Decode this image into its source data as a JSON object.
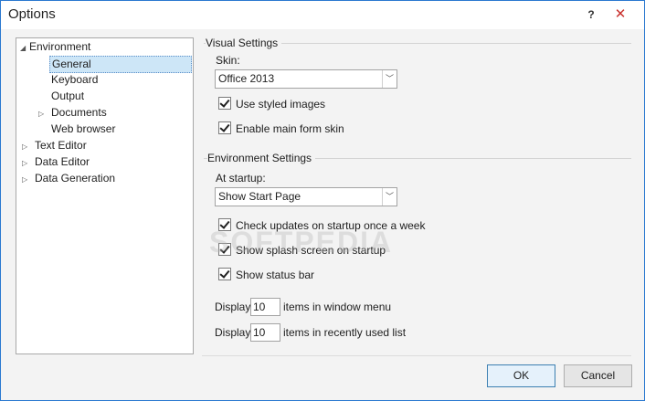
{
  "window": {
    "title": "Options",
    "help_glyph": "?",
    "close_glyph": "✕"
  },
  "tree": [
    {
      "label": "Environment",
      "expanded": true,
      "level": 0
    },
    {
      "label": "General",
      "level": 1,
      "selected": true
    },
    {
      "label": "Keyboard",
      "level": 1
    },
    {
      "label": "Output",
      "level": 1
    },
    {
      "label": "Documents",
      "level": 1,
      "collapsed": true
    },
    {
      "label": "Web browser",
      "level": 1
    },
    {
      "label": "Text Editor",
      "level": 0,
      "collapsed": true
    },
    {
      "label": "Data Editor",
      "level": 0,
      "collapsed": true
    },
    {
      "label": "Data Generation",
      "level": 0,
      "collapsed": true
    }
  ],
  "visual": {
    "group_title": "Visual Settings",
    "skin_label": "Skin:",
    "skin_value": "Office 2013",
    "use_styled_images": "Use styled images",
    "enable_main_form_skin": "Enable main form skin"
  },
  "environment": {
    "group_title": "Environment Settings",
    "startup_label": "At startup:",
    "startup_value": "Show Start Page",
    "check_updates": "Check updates on startup once a week",
    "show_splash": "Show splash screen on startup",
    "show_status_bar": "Show status bar",
    "display_label": "Display",
    "window_menu_count": "10",
    "window_menu_suffix": "items in window menu",
    "recent_count": "10",
    "recent_suffix": "items in recently used list"
  },
  "buttons": {
    "ok": "OK",
    "cancel": "Cancel"
  },
  "watermark": "SOFTPEDIA"
}
